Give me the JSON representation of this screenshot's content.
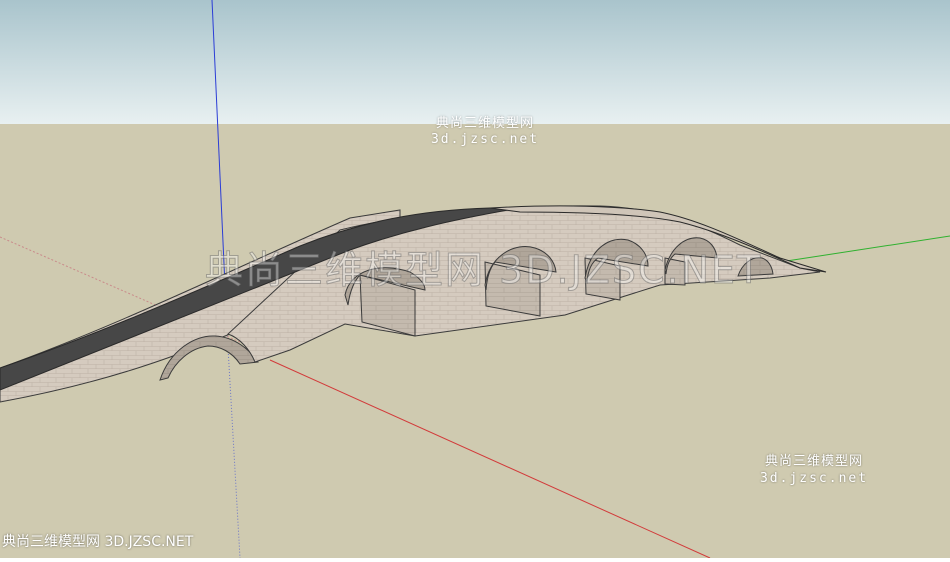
{
  "watermarks": {
    "top": {
      "line1": "典尚三维模型网",
      "line2": "3d.jzsc.net"
    },
    "bottom_right": {
      "line1": "典尚三维模型网",
      "line2": "3d.jzsc.net"
    },
    "center": "典尚三维模型网 3D.JZSC.NET",
    "bottom_left": "典尚三维模型网 3D.JZSC.NET"
  },
  "scene": {
    "sky_top_color": "#a9c4cc",
    "sky_bottom_color": "#e4eef0",
    "ground_color": "#cfcab0",
    "stone_color": "#d2c8bc",
    "road_color": "#474747",
    "axis_colors": {
      "blue": "#2b3dd6",
      "red": "#d23a3a",
      "green": "#2fb12f"
    }
  }
}
